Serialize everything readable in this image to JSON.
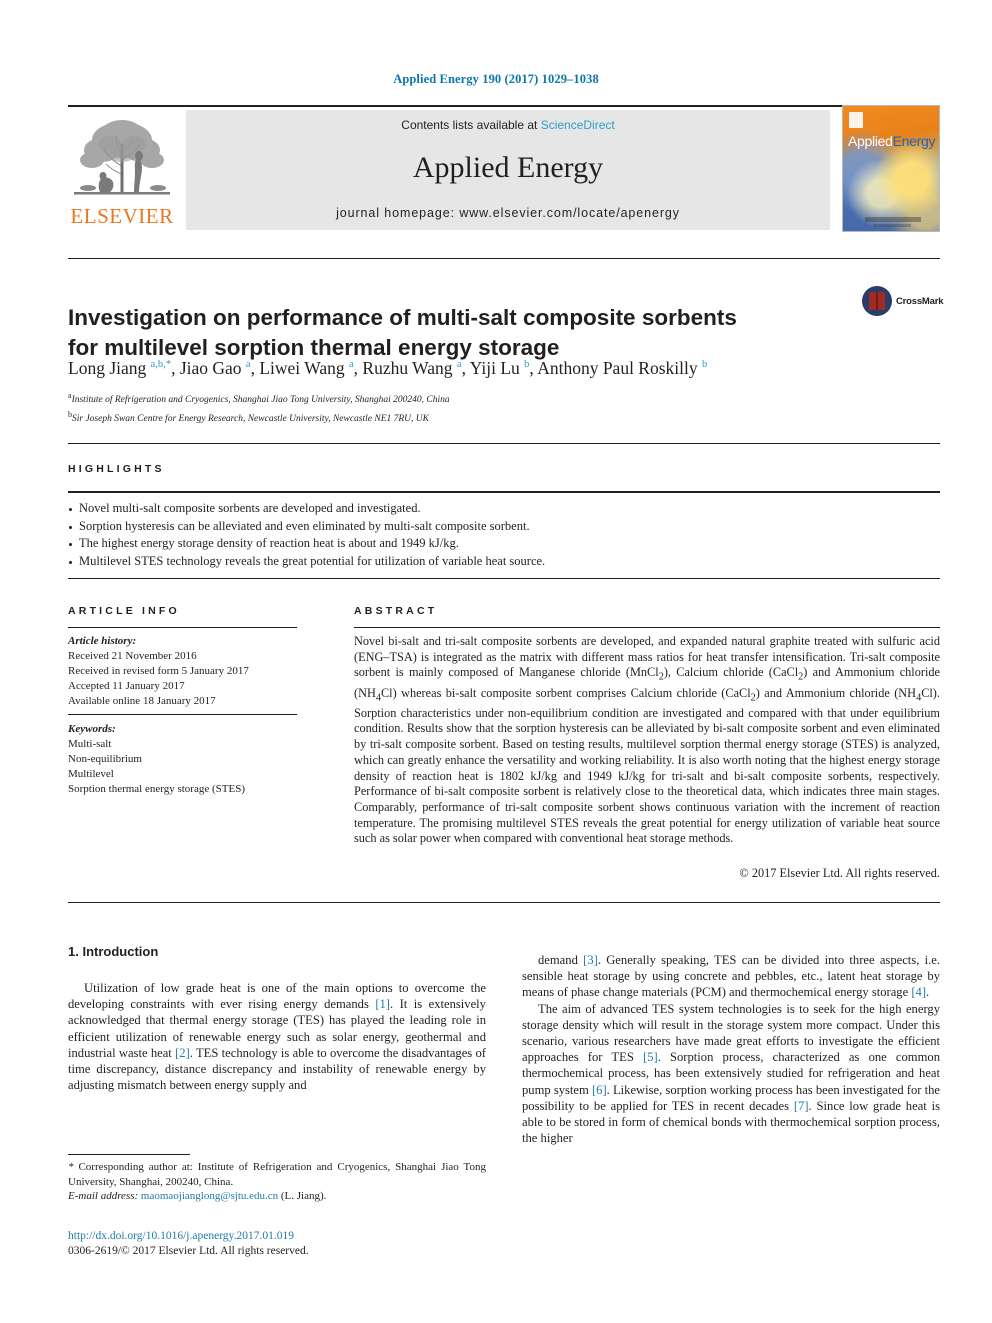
{
  "running_head": "Applied Energy 190 (2017) 1029–1038",
  "masthead": {
    "contents_prefix": "Contents lists available at ",
    "sciencedirect": "ScienceDirect",
    "journal_name": "Applied Energy",
    "homepage": "journal homepage: www.elsevier.com/locate/apenergy",
    "publisher_logo": "ELSEVIER",
    "cover_title_a": "Applied",
    "cover_title_b": "Energy"
  },
  "article": {
    "title": "Investigation on performance of multi-salt composite sorbents for multilevel sorption thermal energy storage",
    "crossmark_label": "CrossMark",
    "authors_html": "Long Jiang <sup>a,b,</sup><sup>*</sup>, Jiao Gao <sup>a</sup>, Liwei Wang <sup>a</sup>, Ruzhu Wang <sup>a</sup>, Yiji Lu <sup>b</sup>, Anthony Paul Roskilly <sup>b</sup>",
    "affiliations": [
      "Institute of Refrigeration and Cryogenics, Shanghai Jiao Tong University, Shanghai 200240, China",
      "Sir Joseph Swan Centre for Energy Research, Newcastle University, Newcastle NE1 7RU, UK"
    ],
    "affiliation_marks": [
      "a",
      "b"
    ]
  },
  "highlights": {
    "heading": "HIGHLIGHTS",
    "items": [
      "Novel multi-salt composite sorbents are developed and investigated.",
      "Sorption hysteresis can be alleviated and even eliminated by multi-salt composite sorbent.",
      "The highest energy storage density of reaction heat is about and 1949 kJ/kg.",
      "Multilevel STES technology reveals the great potential for utilization of variable heat source."
    ]
  },
  "article_info": {
    "heading": "ARTICLE INFO",
    "history_label": "Article history:",
    "history": [
      "Received 21 November 2016",
      "Received in revised form 5 January 2017",
      "Accepted 11 January 2017",
      "Available online 18 January 2017"
    ],
    "keywords_label": "Keywords:",
    "keywords": [
      "Multi-salt",
      "Non-equilibrium",
      "Multilevel",
      "Sorption thermal energy storage (STES)"
    ]
  },
  "abstract": {
    "heading": "ABSTRACT",
    "text_html": "Novel bi-salt and tri-salt composite sorbents are developed, and expanded natural graphite treated with sulfuric acid (ENG–TSA) is integrated as the matrix with different mass ratios for heat transfer intensification. Tri-salt composite sorbent is mainly composed of Manganese chloride (MnCl<sub>2</sub>), Calcium chloride (CaCl<sub>2</sub>) and Ammonium chloride (NH<sub>4</sub>Cl) whereas bi-salt composite sorbent comprises Calcium chloride (CaCl<sub>2</sub>) and Ammonium chloride (NH<sub>4</sub>Cl). Sorption characteristics under non-equilibrium condition are investigated and compared with that under equilibrium condition. Results show that the sorption hysteresis can be alleviated by bi-salt composite sorbent and even eliminated by tri-salt composite sorbent. Based on testing results, multilevel sorption thermal energy storage (STES) is analyzed, which can greatly enhance the versatility and working reliability. It is also worth noting that the highest energy storage density of reaction heat is 1802 kJ/kg and 1949 kJ/kg for tri-salt and bi-salt composite sorbents, respectively. Performance of bi-salt composite sorbent is relatively close to the theoretical data, which indicates three main stages. Comparably, performance of tri-salt composite sorbent shows continuous variation with the increment of reaction temperature. The promising multilevel STES reveals the great potential for energy utilization of variable heat source such as solar power when compared with conventional heat storage methods.",
    "copyright": "© 2017 Elsevier Ltd. All rights reserved."
  },
  "body": {
    "section_title": "1. Introduction",
    "left_paragraphs_html": [
      "Utilization of low grade heat is one of the main options to overcome the developing constraints with ever rising energy demands <span class=\"ref\">[1]</span>. It is extensively acknowledged that thermal energy storage (TES) has played the leading role in efficient utilization of renewable energy such as solar energy, geothermal and industrial waste heat <span class=\"ref\">[2]</span>. TES technology is able to overcome the disadvantages of time discrepancy, distance discrepancy and instability of renewable energy by adjusting mismatch between energy supply and"
    ],
    "right_paragraphs_html": [
      "demand <span class=\"ref\">[3]</span>. Generally speaking, TES can be divided into three aspects, i.e. sensible heat storage by using concrete and pebbles, etc., latent heat storage by means of phase change materials (PCM) and thermochemical energy storage <span class=\"ref\">[4]</span>.",
      "The aim of advanced TES system technologies is to seek for the high energy storage density which will result in the storage system more compact. Under this scenario, various researchers have made great efforts to investigate the efficient approaches for TES <span class=\"ref\">[5]</span>. Sorption process, characterized as one common thermochemical process, has been extensively studied for refrigeration and heat pump system <span class=\"ref\">[6]</span>. Likewise, sorption working process has been investigated for the possibility to be applied for TES in recent decades <span class=\"ref\">[7]</span>. Since low grade heat is able to be stored in form of chemical bonds with thermochemical sorption process, the higher"
    ]
  },
  "footer": {
    "corresponding_html": "<span class=\"em\">*</span> Corresponding author at: Institute of Refrigeration and Cryogenics, Shanghai Jiao Tong University, Shanghai, 200240, China.",
    "email_label": "E-mail address:",
    "email": "maomaojianglong@sjtu.edu.cn",
    "email_suffix": "(L. Jiang).",
    "doi": "http://dx.doi.org/10.1016/j.apenergy.2017.01.019",
    "issn_line": "0306-2619/© 2017 Elsevier Ltd. All rights reserved."
  },
  "colors": {
    "link_blue": "#1f7ba8",
    "sciencedirect_blue": "#2d9ccc",
    "elsevier_orange": "#e87722",
    "band_gray": "#e6e6e6"
  }
}
